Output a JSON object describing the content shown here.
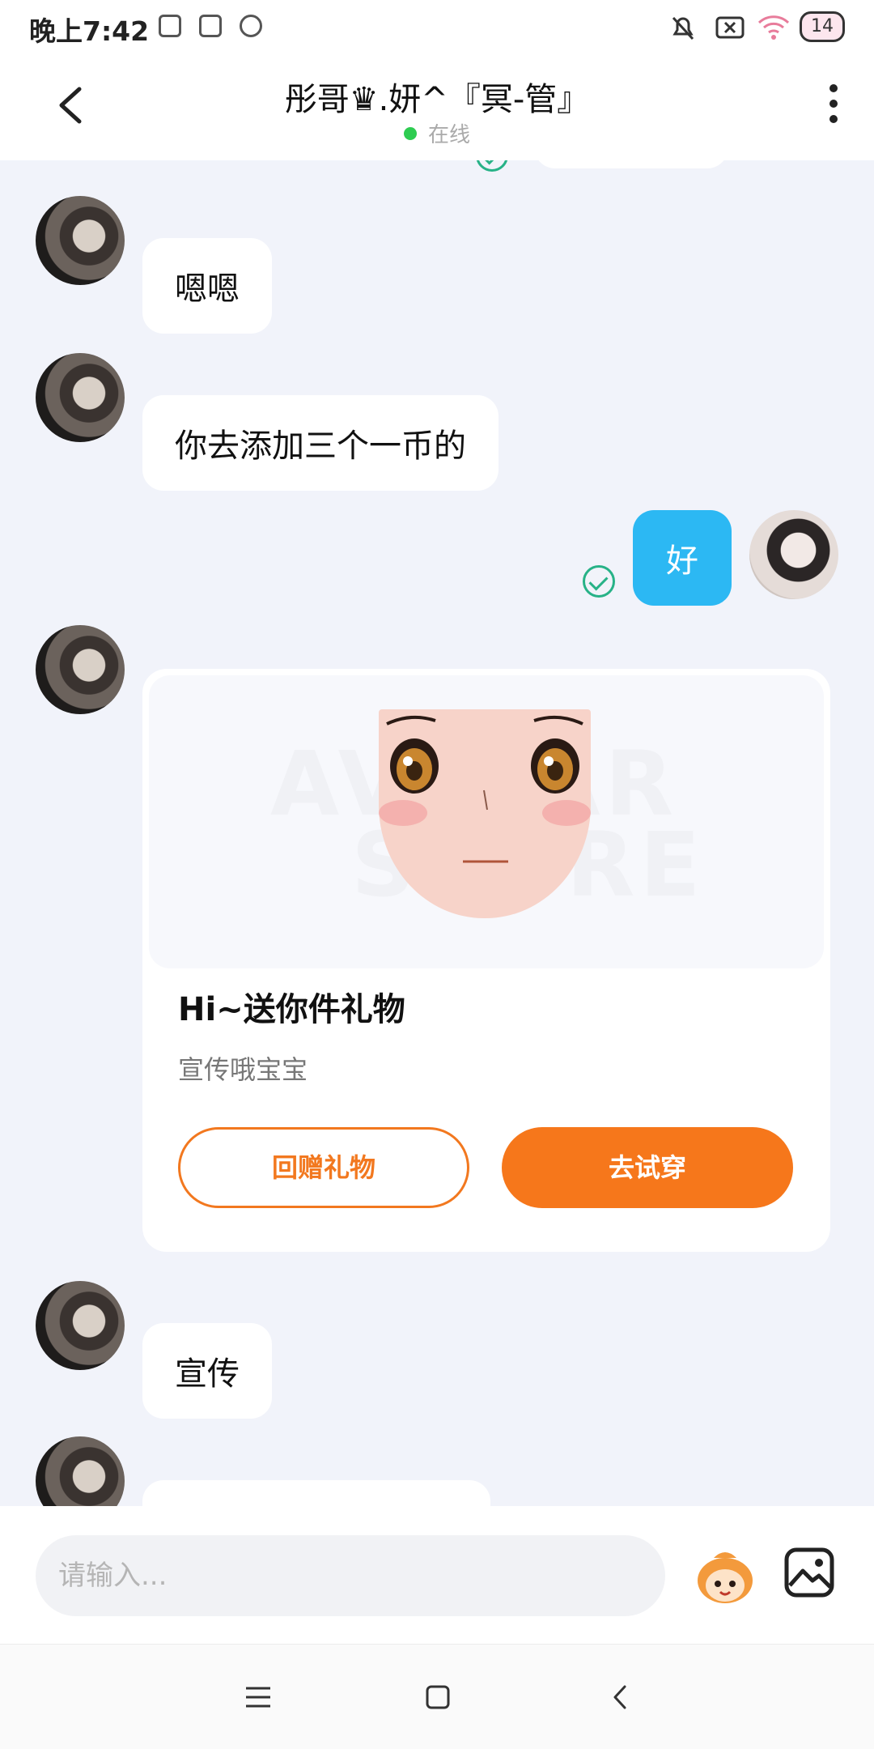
{
  "status_bar": {
    "time": "晚上7:42",
    "battery": "14"
  },
  "header": {
    "title": "彤哥♛.妍^『冥-管』",
    "status": "在线"
  },
  "messages": [
    {
      "from": "other",
      "text": "嗯嗯"
    },
    {
      "from": "other",
      "text": "你去添加三个一币的"
    },
    {
      "from": "me",
      "text": "好"
    },
    {
      "from": "other",
      "type": "gift"
    },
    {
      "from": "other",
      "text": "宣传"
    }
  ],
  "gift_card": {
    "title": "Hi~送你件礼物",
    "subtitle": "宣传哦宝宝",
    "return_gift_label": "回赠礼物",
    "try_on_label": "去试穿",
    "watermark_line1": "AVATAR",
    "watermark_line2": "STORE"
  },
  "input": {
    "placeholder": "请输入..."
  },
  "colors": {
    "accent_orange": "#f6771b",
    "my_bubble": "#2cb8f3",
    "read_check": "#27b287",
    "online_dot": "#2ecc51"
  },
  "icons": {
    "back": "chevron-left-icon",
    "more": "more-vertical-icon",
    "read": "check-circle-icon",
    "emoji": "mascot-emoji-icon",
    "image": "image-icon",
    "nav_menu": "menu-icon",
    "nav_home": "square-home-icon",
    "nav_back": "chevron-left-icon"
  }
}
